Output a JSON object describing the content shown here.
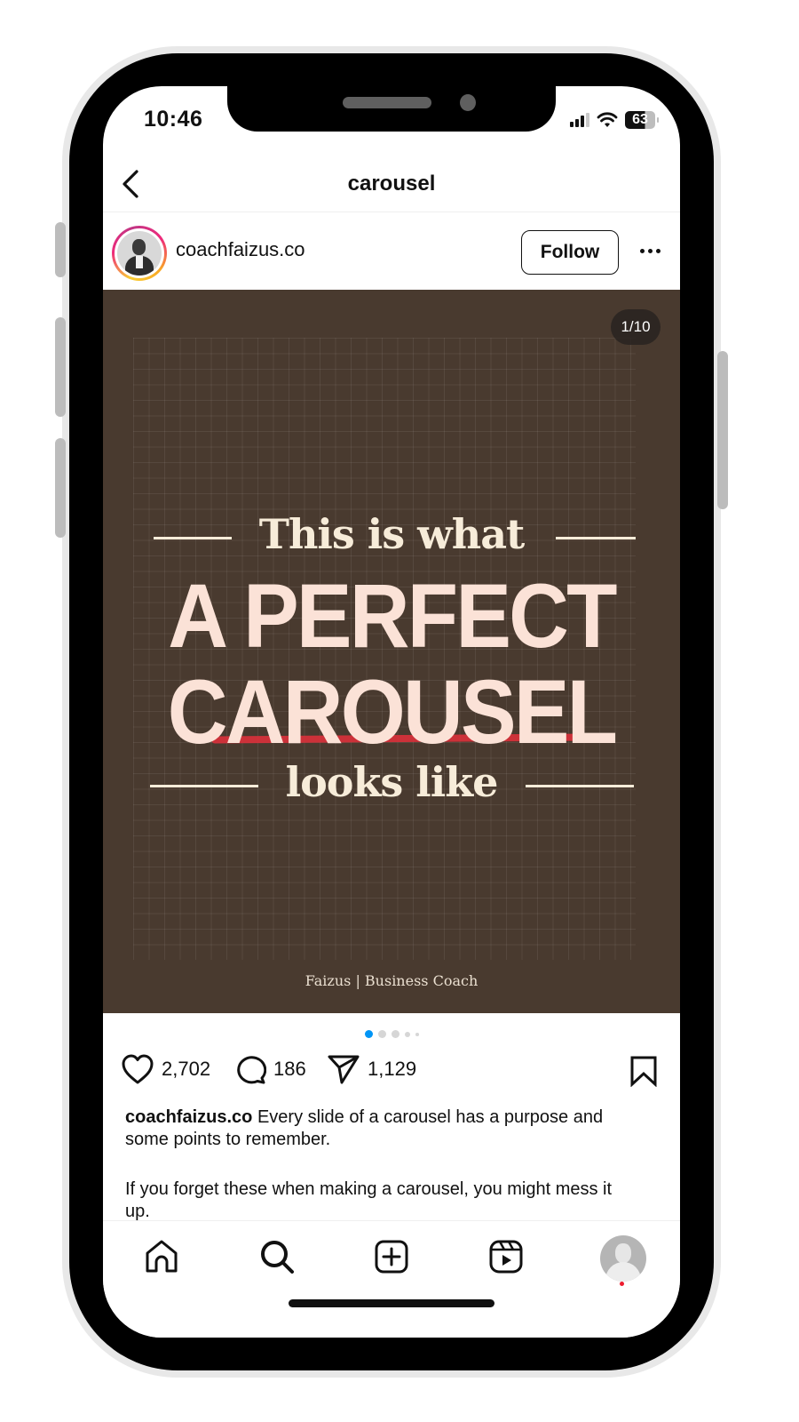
{
  "status_bar": {
    "time": "10:46",
    "battery": "63",
    "icons": [
      "signal-icon",
      "wifi-icon",
      "battery-icon"
    ]
  },
  "nav": {
    "back_icon": "chevron-left-icon",
    "title": "carousel"
  },
  "post": {
    "username": "coachfaizus.co",
    "follow_label": "Follow",
    "more_icon": "more-horizontal-icon",
    "slide": {
      "counter": "1/10",
      "current": 1,
      "total": 10,
      "line1": "This is what",
      "line2": "A PERFECT",
      "line3": "CAROUSEL",
      "line4": "looks like",
      "footer": "Faizus | Business Coach",
      "background_color": "#493a2f",
      "accent_color": "#d8313b"
    },
    "pagination": {
      "dots": 5,
      "active_index": 0,
      "active_color": "#0095f6"
    },
    "actions": {
      "likes": "2,702",
      "comments": "186",
      "shares": "1,129"
    },
    "caption": {
      "username": "coachfaizus.co",
      "text": "Every slide of a carousel has a purpose and some points to remember.",
      "text2": "If you forget these when making a carousel, you might mess it up."
    }
  },
  "tabbar": {
    "items": [
      {
        "name": "home",
        "icon": "home-icon"
      },
      {
        "name": "search",
        "icon": "search-icon"
      },
      {
        "name": "create",
        "icon": "plus-square-icon"
      },
      {
        "name": "reels",
        "icon": "reels-icon"
      },
      {
        "name": "profile",
        "icon": "profile-avatar"
      }
    ]
  }
}
